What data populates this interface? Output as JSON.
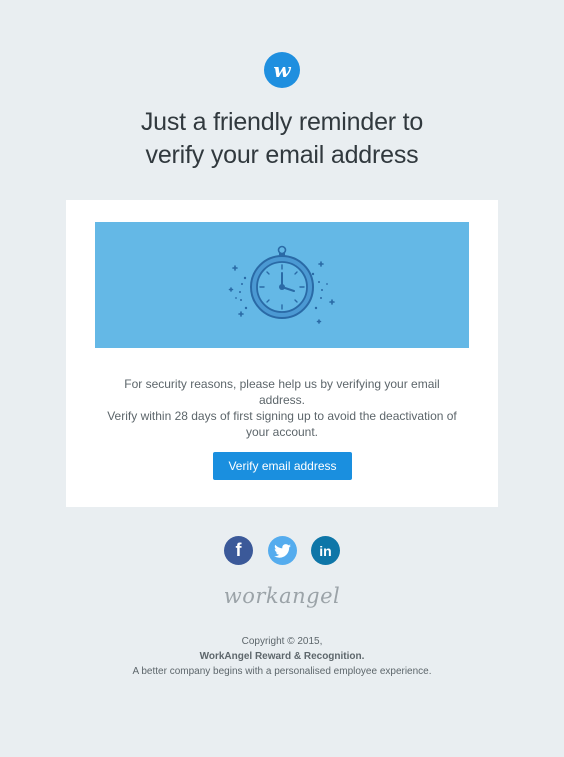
{
  "header": {
    "logo_letter": "w",
    "title_line1": "Just a friendly reminder to",
    "title_line2": "verify your email address"
  },
  "card": {
    "illustration": "stopwatch-icon",
    "body_line1": "For security reasons, please help us by verifying your email address.",
    "body_line2": "Verify within 28 days of first signing up to avoid the deactivation of",
    "body_line3": "your account.",
    "cta_label": "Verify email address"
  },
  "social": {
    "facebook_glyph": "f",
    "linkedin_glyph": "in"
  },
  "footer": {
    "wordmark": "workangel",
    "copyright": "Copyright © 2015,",
    "company": "WorkAngel Reward & Recognition.",
    "tagline": "A better company begins with a personalised employee experience."
  },
  "colors": {
    "background": "#e9eef1",
    "accent": "#1a8fdf",
    "hero": "#64b8e6",
    "facebook": "#3b5999",
    "twitter": "#55acee",
    "linkedin": "#0e76a8"
  }
}
